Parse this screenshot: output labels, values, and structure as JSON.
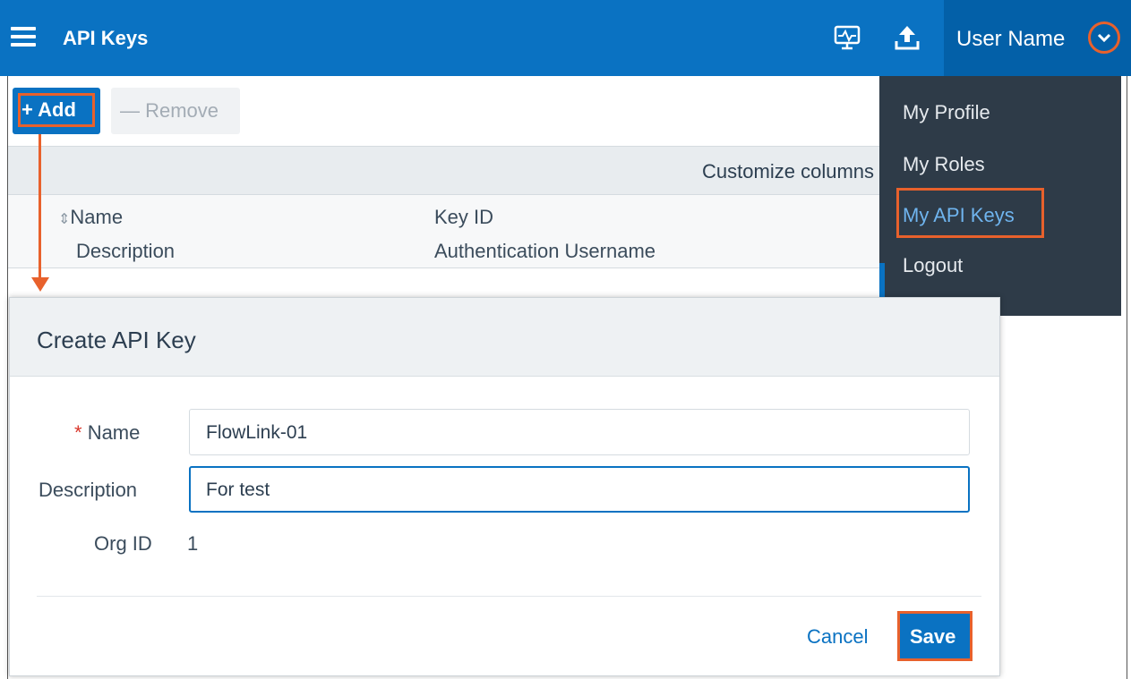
{
  "header": {
    "title": "API Keys",
    "user_name": "User Name",
    "icons": [
      "menu-icon",
      "monitor-icon",
      "upload-icon",
      "chevron-down-icon"
    ]
  },
  "toolbar": {
    "add_label": "+ Add",
    "remove_label": "— Remove"
  },
  "table": {
    "customize_label": "Customize columns",
    "columns_row1": [
      "Name",
      "Key ID"
    ],
    "columns_row2": [
      "Description",
      "Authentication Username"
    ],
    "sort_icon": "⇕"
  },
  "user_menu": {
    "items": [
      "My Profile",
      "My Roles",
      "My API Keys",
      "Logout"
    ],
    "active_item": "My API Keys"
  },
  "dialog": {
    "title": "Create API Key",
    "required_marker": "*",
    "name_label": "Name",
    "name_value": "FlowLink-01",
    "description_label": "Description",
    "description_value": "For test",
    "org_label": "Org ID",
    "org_value": "1",
    "cancel_label": "Cancel",
    "save_label": "Save"
  },
  "colors": {
    "header_bg": "#0a72c2",
    "highlight": "#e8612c",
    "menu_bg": "#2e3b48"
  }
}
